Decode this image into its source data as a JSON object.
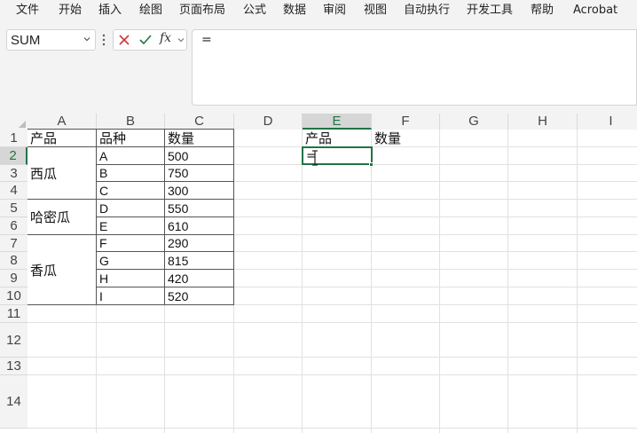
{
  "menu": {
    "items": [
      {
        "label": "文件"
      },
      {
        "label": "开始"
      },
      {
        "label": "插入"
      },
      {
        "label": "绘图"
      },
      {
        "label": "页面布局"
      },
      {
        "label": "公式"
      },
      {
        "label": "数据"
      },
      {
        "label": "审阅"
      },
      {
        "label": "视图"
      },
      {
        "label": "自动执行"
      },
      {
        "label": "开发工具"
      },
      {
        "label": "帮助"
      },
      {
        "label": "Acrobat"
      }
    ]
  },
  "formula_bar": {
    "name_box": "SUM",
    "fx_label": "fx",
    "content": "="
  },
  "columns": [
    "A",
    "B",
    "C",
    "D",
    "E",
    "F",
    "G",
    "H",
    "I"
  ],
  "rows": [
    "1",
    "2",
    "3",
    "4",
    "5",
    "6",
    "7",
    "8",
    "9",
    "10",
    "11",
    "12",
    "13",
    "14"
  ],
  "table": {
    "headers": {
      "product": "产品",
      "variety": "品种",
      "quantity": "数量"
    },
    "groups": [
      {
        "product": "西瓜"
      },
      {
        "product": "哈密瓜"
      },
      {
        "product": "香瓜"
      }
    ],
    "rows": [
      {
        "variety": "A",
        "quantity": "500"
      },
      {
        "variety": "B",
        "quantity": "750"
      },
      {
        "variety": "C",
        "quantity": "300"
      },
      {
        "variety": "D",
        "quantity": "550"
      },
      {
        "variety": "E",
        "quantity": "610"
      },
      {
        "variety": "F",
        "quantity": "290"
      },
      {
        "variety": "G",
        "quantity": "815"
      },
      {
        "variety": "H",
        "quantity": "420"
      },
      {
        "variety": "I",
        "quantity": "520"
      }
    ]
  },
  "summary": {
    "product_header": "产品",
    "quantity_header": "数量",
    "active_cell_text": "="
  },
  "colors": {
    "accent": "#217346",
    "chrome": "#f3f3f3"
  }
}
